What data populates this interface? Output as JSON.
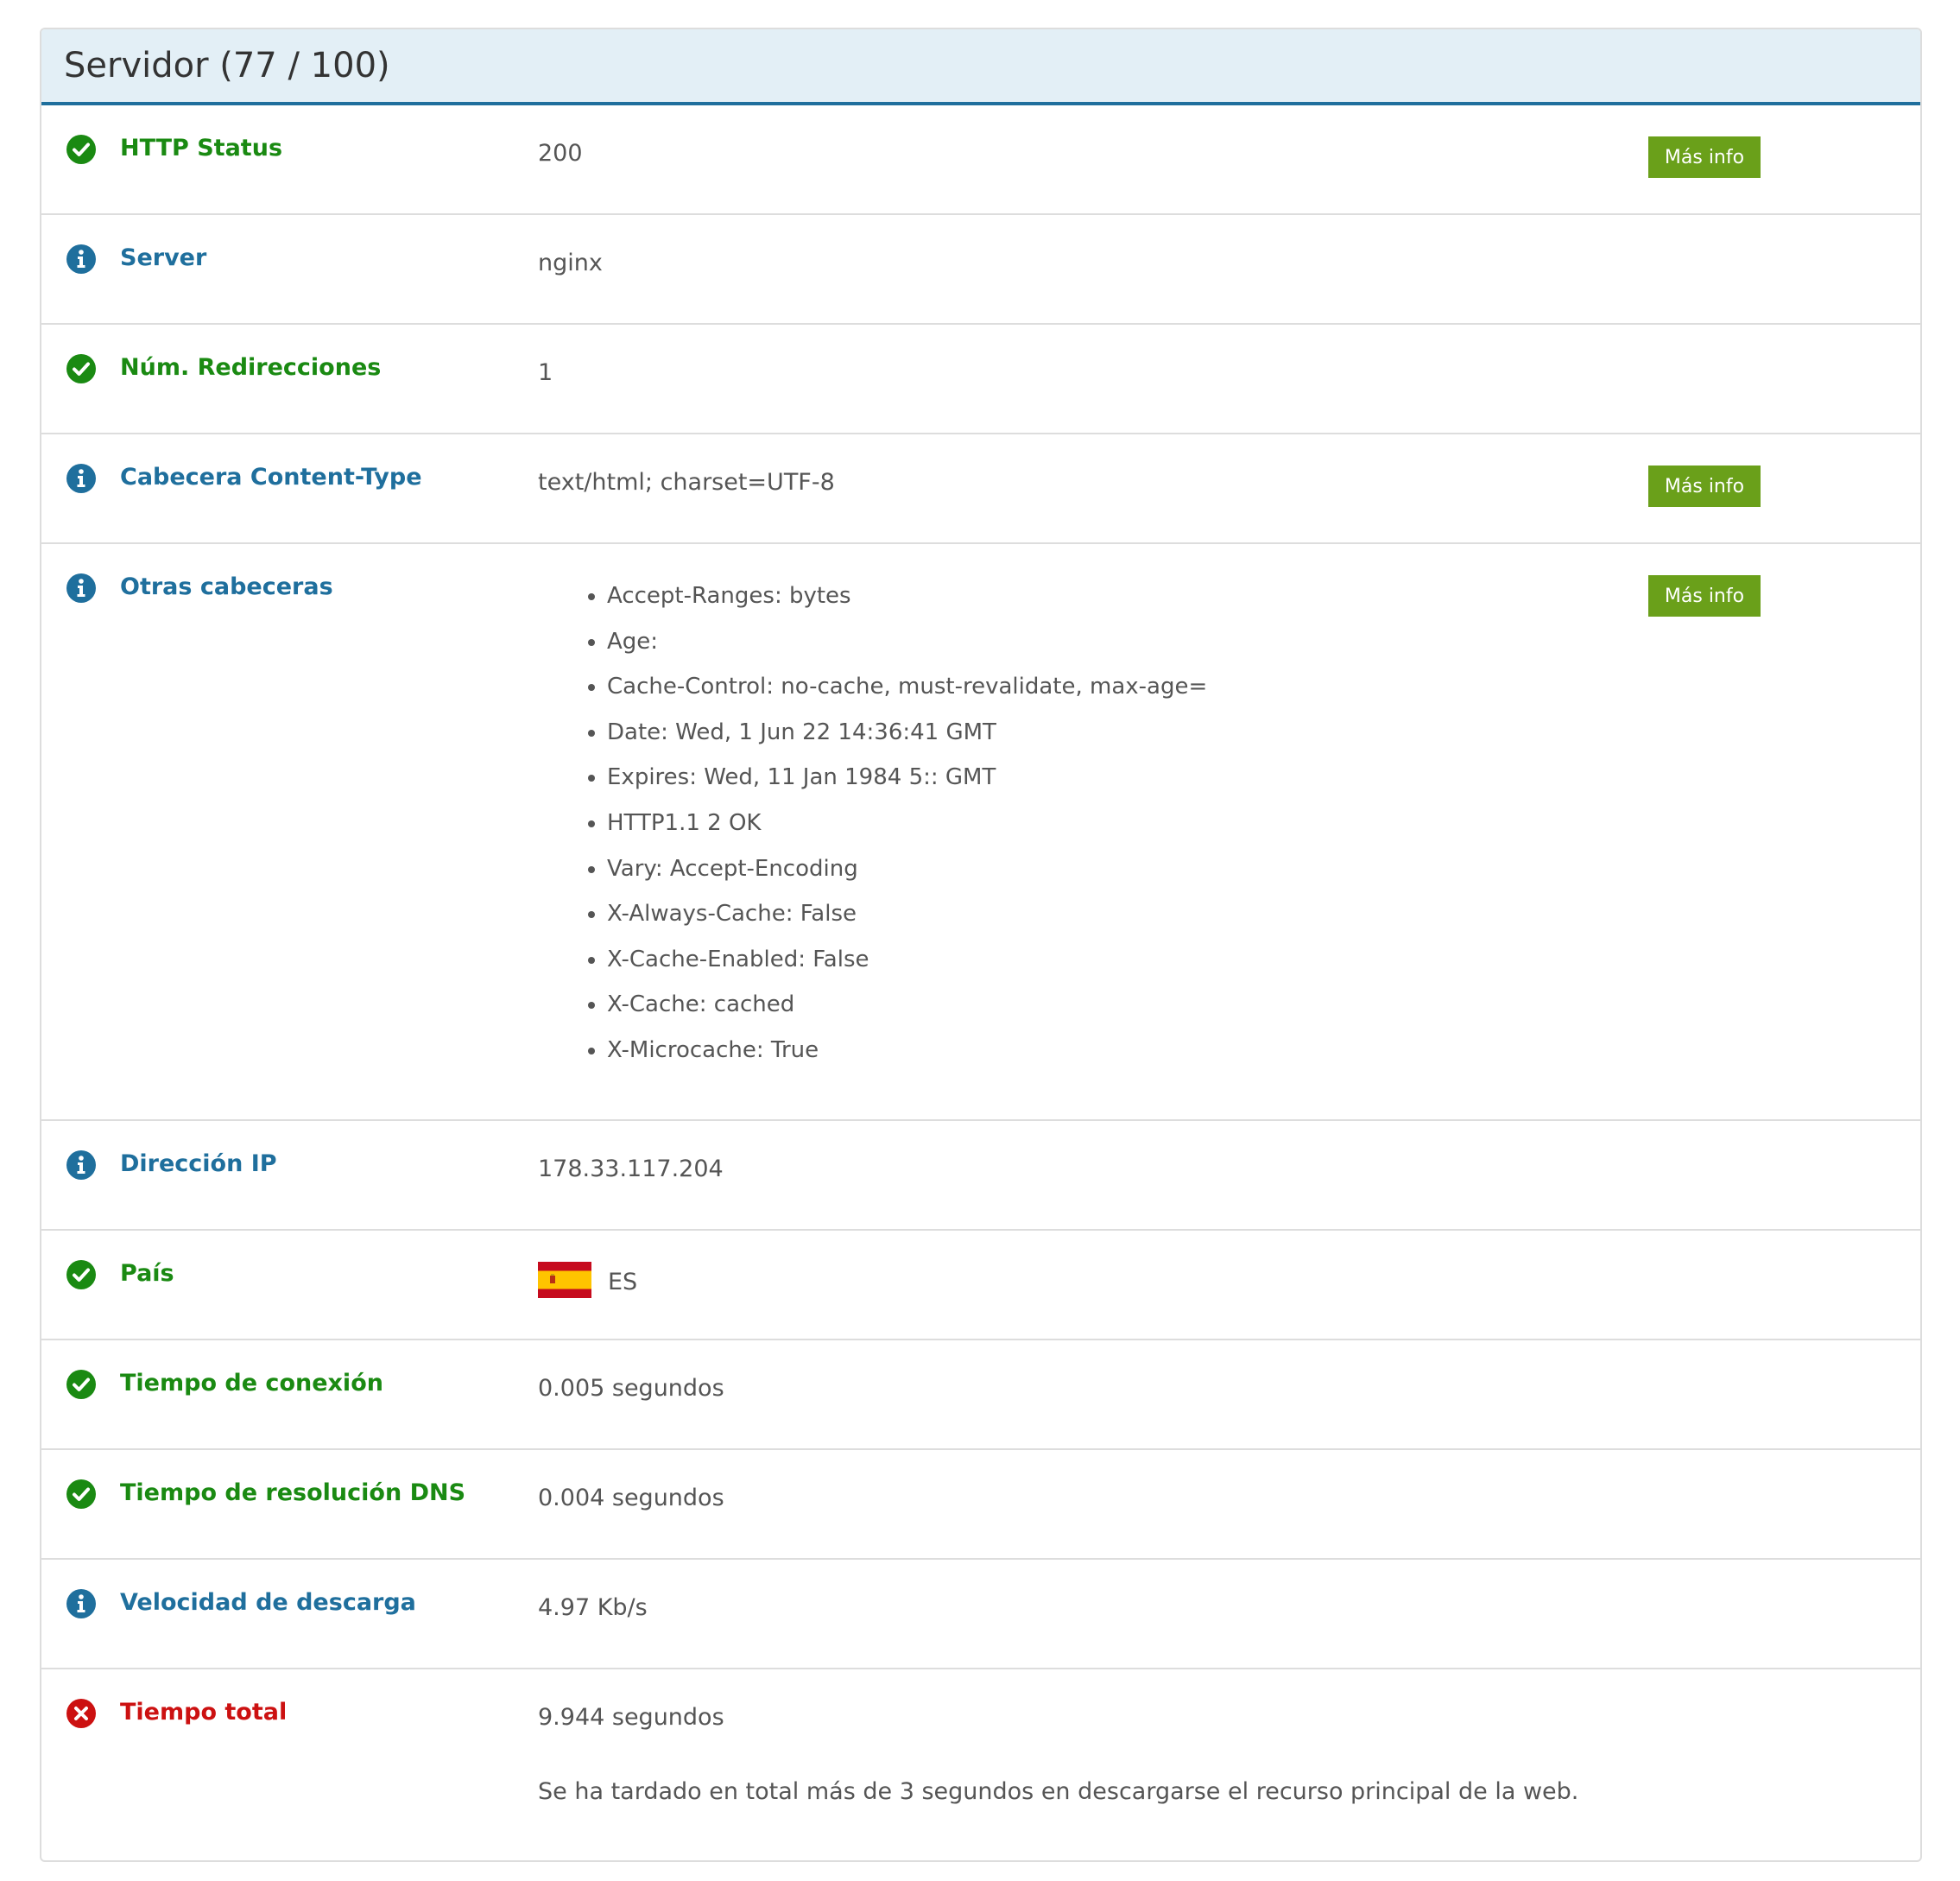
{
  "panel": {
    "title": "Servidor (77 / 100)"
  },
  "colors": {
    "ok": "#1a8a12",
    "info": "#1f6f9d",
    "error": "#cc1111",
    "button": "#6aa01a",
    "header_bg": "#e3eff6"
  },
  "rows": [
    {
      "label": "HTTP Status",
      "status": "ok",
      "icon": "check-circle-icon",
      "value": "200",
      "button": "Más info"
    },
    {
      "label": "Server",
      "status": "info",
      "icon": "info-circle-icon",
      "value": "nginx"
    },
    {
      "label": "Núm. Redirecciones",
      "status": "ok",
      "icon": "check-circle-icon",
      "value": "1"
    },
    {
      "label": "Cabecera Content-Type",
      "status": "info",
      "icon": "info-circle-icon",
      "value": "text/html; charset=UTF-8",
      "button": "Más info"
    },
    {
      "label": "Otras cabeceras",
      "status": "info",
      "icon": "info-circle-icon",
      "button": "Más info",
      "headers": [
        "Accept-Ranges: bytes",
        "Age:",
        "Cache-Control: no-cache, must-revalidate, max-age=",
        "Date: Wed, 1 Jun 22 14:36:41 GMT",
        "Expires: Wed, 11 Jan 1984 5:: GMT",
        "HTTP1.1 2 OK",
        "Vary: Accept-Encoding",
        "X-Always-Cache: False",
        "X-Cache-Enabled: False",
        "X-Cache: cached",
        "X-Microcache: True"
      ]
    },
    {
      "label": "Dirección IP",
      "status": "info",
      "icon": "info-circle-icon",
      "value": "178.33.117.204"
    },
    {
      "label": "País",
      "status": "ok",
      "icon": "check-circle-icon",
      "value": "ES",
      "flag": "spain-flag-icon"
    },
    {
      "label": "Tiempo de conexión",
      "status": "ok",
      "icon": "check-circle-icon",
      "value": "0.005 segundos"
    },
    {
      "label": "Tiempo de resolución DNS",
      "status": "ok",
      "icon": "check-circle-icon",
      "value": "0.004 segundos"
    },
    {
      "label": "Velocidad de descarga",
      "status": "info",
      "icon": "info-circle-icon",
      "value": "4.97 Kb/s"
    },
    {
      "label": "Tiempo total",
      "status": "error",
      "icon": "x-circle-icon",
      "value": "9.944 segundos",
      "note": "Se ha tardado en total más de 3 segundos en descargarse el recurso principal de la web."
    }
  ]
}
